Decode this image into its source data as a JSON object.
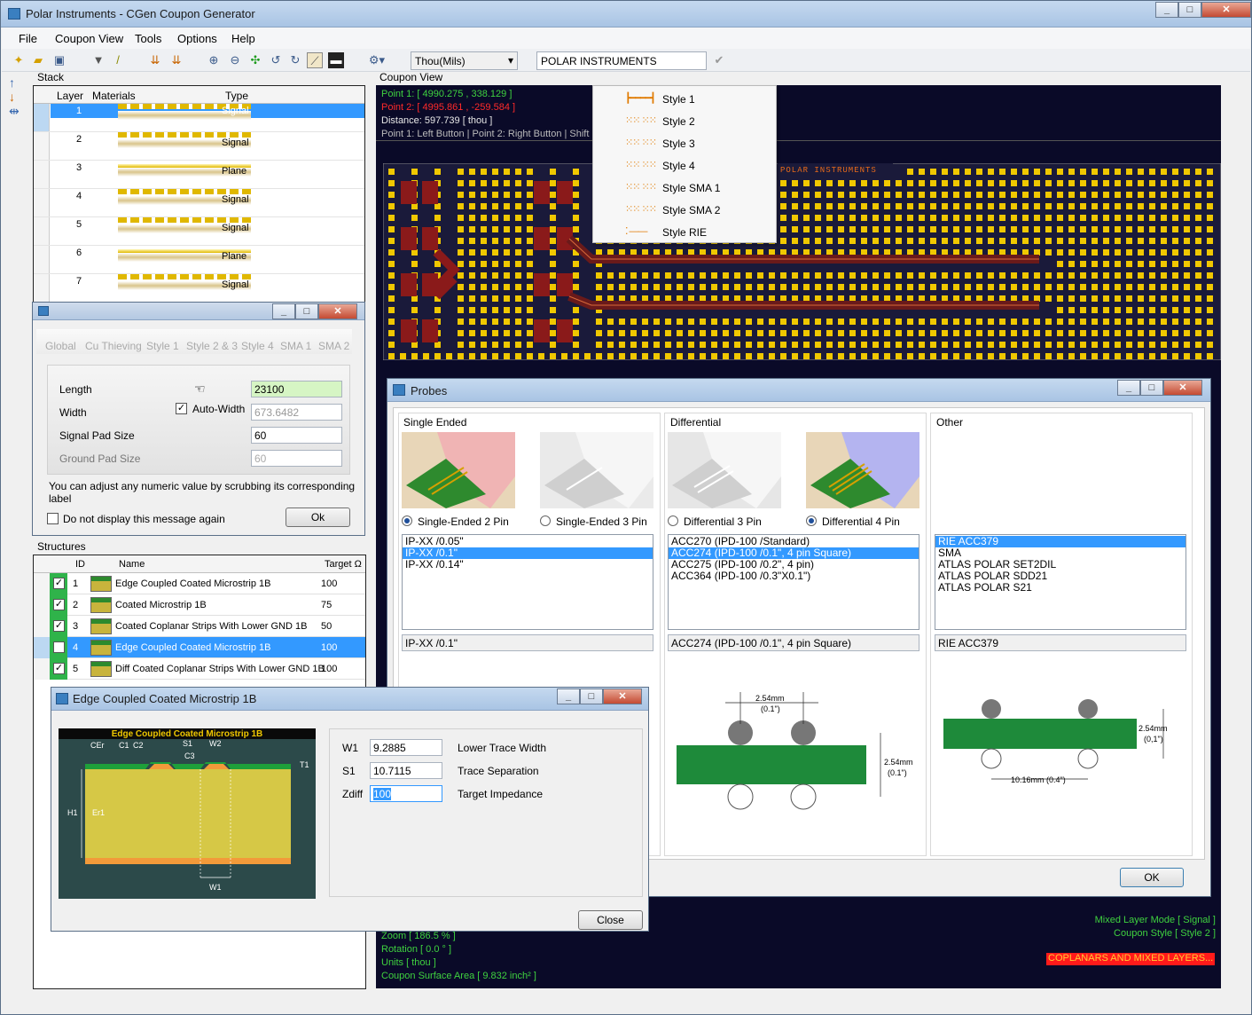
{
  "window": {
    "title": "Polar Instruments  -  CGen Coupon Generator"
  },
  "menu": [
    "File",
    "Coupon View",
    "Tools",
    "Options",
    "Help"
  ],
  "toolbar": {
    "units": "Thou(Mils)",
    "label_text": "POLAR INSTRUMENTS"
  },
  "stack": {
    "label": "Stack",
    "headers": [
      "Layer",
      "Materials",
      "Type"
    ],
    "rows": [
      {
        "layer": "1",
        "type": "Signal",
        "kind": "signal"
      },
      {
        "layer": "2",
        "type": "Signal",
        "kind": "signal"
      },
      {
        "layer": "3",
        "type": "Plane",
        "kind": "plane"
      },
      {
        "layer": "4",
        "type": "Signal",
        "kind": "signal"
      },
      {
        "layer": "5",
        "type": "Signal",
        "kind": "signal"
      },
      {
        "layer": "6",
        "type": "Plane",
        "kind": "plane"
      },
      {
        "layer": "7",
        "type": "Signal",
        "kind": "signal"
      }
    ]
  },
  "global_dialog": {
    "tabs": [
      "Global",
      "Cu Thieving",
      "Style 1",
      "Style 2 & 3",
      "Style 4",
      "SMA 1",
      "SMA 2"
    ],
    "fields": [
      {
        "label": "Length",
        "value": "23100"
      },
      {
        "label": "Width",
        "value": "673.6482"
      },
      {
        "label": "Signal Pad Size",
        "value": "60"
      },
      {
        "label": "Ground Pad Size",
        "value": "60"
      }
    ],
    "auto_width": "Auto-Width",
    "hint": "You can adjust any numeric value by scrubbing its corresponding label",
    "dont_show": "Do not display this message again",
    "ok": "Ok"
  },
  "structures": {
    "label": "Structures",
    "headers": [
      "ID",
      "Name",
      "Target Ω"
    ],
    "rows": [
      {
        "id": "1",
        "name": "Edge Coupled Coated Microstrip 1B",
        "target": "100"
      },
      {
        "id": "2",
        "name": "Coated Microstrip 1B",
        "target": "75"
      },
      {
        "id": "3",
        "name": "Coated Coplanar Strips With Lower GND 1B",
        "target": "50"
      },
      {
        "id": "4",
        "name": "Edge Coupled Coated Microstrip 1B",
        "target": "100"
      },
      {
        "id": "5",
        "name": "Diff Coated Coplanar Strips With Lower GND 1B",
        "target": "100"
      }
    ]
  },
  "coupon_view": {
    "label": "Coupon View",
    "point1": "Point 1: [ 4990.275 , 338.129 ]",
    "point2": "Point 2: [ 4995.861 , -259.584 ]",
    "distance": "Distance: 597.739 [ thou ]",
    "hint": "Point 1: Left Button | Point 2: Right Button | Shift",
    "brand": "POLAR INSTRUMENTS",
    "status_left": [
      "Zoom [ 186.5 % ]",
      "Rotation [ 0.0 ° ]",
      "Units [ thou ]",
      "Coupon Surface Area [ 9.832 inch² ]"
    ],
    "status_right": [
      "Mixed Layer Mode [ Signal ]",
      "Coupon Style [ Style 2 ]"
    ],
    "warning": "COPLANARS AND MIXED LAYERS..."
  },
  "style_menu": [
    "Style 1",
    "Style 2",
    "Style 3",
    "Style 4",
    "Style SMA 1",
    "Style SMA 2",
    "Style RIE"
  ],
  "probes": {
    "title": "Probes",
    "groups": [
      "Single Ended",
      "Differential",
      "Other"
    ],
    "options": [
      "Single-Ended 2 Pin",
      "Single-Ended 3 Pin",
      "Differential 3 Pin",
      "Differential 4 Pin"
    ],
    "se_list": [
      "IP-XX /0.05\"",
      "IP-XX /0.1\"",
      "IP-XX /0.14\""
    ],
    "se_selected": "IP-XX /0.1\"",
    "diff_list": [
      "ACC270 (IPD-100 /Standard)",
      "ACC274 (IPD-100 /0.1\", 4 pin Square)",
      "ACC275 (IPD-100 /0.2\", 4 pin)",
      "ACC364 (IPD-100 /0.3\"X0.1\")"
    ],
    "diff_selected": "ACC274 (IPD-100 /0.1\", 4 pin Square)",
    "other_list": [
      "RIE ACC379",
      "SMA",
      "ATLAS POLAR SET2DIL",
      "ATLAS POLAR SDD21",
      "ATLAS POLAR S21"
    ],
    "other_selected": "RIE ACC379",
    "diff_dims": {
      "top": "2.54mm",
      "top2": "(0.1\")",
      "side": "2.54mm",
      "side2": "(0.1\")"
    },
    "other_dims": {
      "side": "2.54mm",
      "side2": "(0,1\")",
      "bottom": "10.16mm (0.4\")"
    },
    "ok": "OK"
  },
  "ecm_dialog": {
    "title": "Edge Coupled Coated Microstrip 1B",
    "diagram_title": "Edge Coupled Coated Microstrip 1B",
    "labels": {
      "cer": "CEr",
      "c1": "C1",
      "c2": "C2",
      "s1": "S1",
      "w2": "W2",
      "c3": "C3",
      "t1": "T1",
      "h1": "H1",
      "er1": "Er1",
      "w1": "W1"
    },
    "fields": [
      {
        "name": "W1",
        "value": "9.2885",
        "desc": "Lower Trace Width"
      },
      {
        "name": "S1",
        "value": "10.7115",
        "desc": "Trace Separation"
      },
      {
        "name": "Zdiff",
        "value": "100",
        "desc": "Target Impedance"
      }
    ],
    "close": "Close"
  }
}
